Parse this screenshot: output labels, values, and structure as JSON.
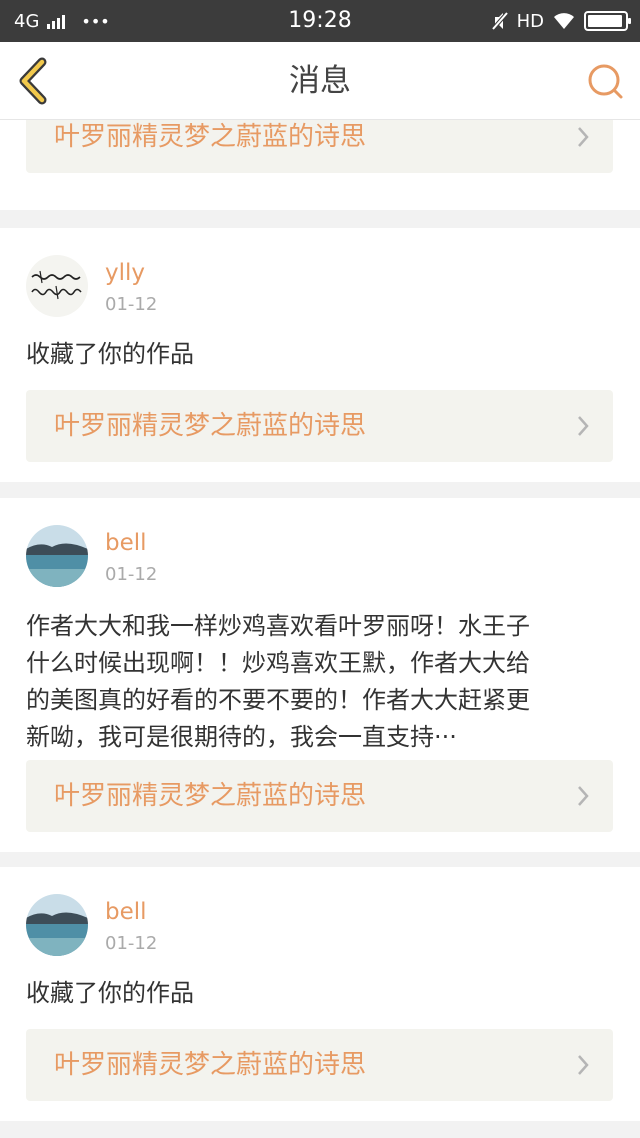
{
  "status_bar": {
    "network": "4G",
    "more": "•••",
    "time": "19:28",
    "hd": "HD",
    "battery_level": 0.95,
    "icons": [
      "signal-icon",
      "mute-icon",
      "wifi-icon",
      "battery-icon"
    ]
  },
  "header": {
    "title": "消息",
    "back_icon": "back-chevron-icon",
    "search_icon": "search-icon",
    "accent_color": "#e79a63"
  },
  "messages": [
    {
      "work_title": "叶罗丽精灵梦之蔚蓝的诗思"
    },
    {
      "user": "ylly",
      "date": "01-12",
      "text": "收藏了你的作品",
      "work_title": "叶罗丽精灵梦之蔚蓝的诗思"
    },
    {
      "user": "bell",
      "date": "01-12",
      "lines": [
        "作者大大和我一样炒鸡喜欢看叶罗丽呀！水王子",
        "什么时候出现啊！！炒鸡喜欢王默，作者大大给",
        "的美图真的好看的不要不要的！作者大大赶紧更",
        "新呦，我可是很期待的，我会一直支持···"
      ],
      "work_title": "叶罗丽精灵梦之蔚蓝的诗思"
    },
    {
      "user": "bell",
      "date": "01-12",
      "text": "收藏了你的作品",
      "work_title": "叶罗丽精灵梦之蔚蓝的诗思"
    }
  ]
}
